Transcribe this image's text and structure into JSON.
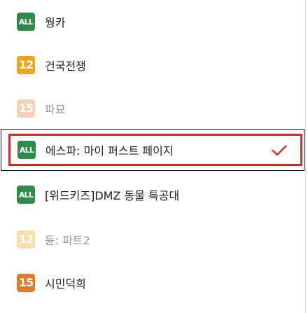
{
  "movies": [
    {
      "title": "웡카",
      "rating": "ALL",
      "rating_color": "#2e8b4a",
      "enabled": true,
      "selected": false
    },
    {
      "title": "건국전쟁",
      "rating": "12",
      "rating_color": "#e9a51c",
      "enabled": true,
      "selected": false
    },
    {
      "title": "파묘",
      "rating": "15",
      "rating_color": "#e07a2e",
      "enabled": false,
      "selected": false
    },
    {
      "title": "에스파: 마이 퍼스트 페이지",
      "rating": "ALL",
      "rating_color": "#2e8b4a",
      "enabled": true,
      "selected": true
    },
    {
      "title": "[위드키즈]DMZ 동물 특공대",
      "rating": "ALL",
      "rating_color": "#2e8b4a",
      "enabled": true,
      "selected": false
    },
    {
      "title": "듄: 파트2",
      "rating": "12",
      "rating_color": "#e9a51c",
      "enabled": false,
      "selected": false
    },
    {
      "title": "시민덕희",
      "rating": "15",
      "rating_color": "#e07a2e",
      "enabled": true,
      "selected": false
    }
  ],
  "selection_icon": "check-icon",
  "selection_color": "#d62b2b"
}
